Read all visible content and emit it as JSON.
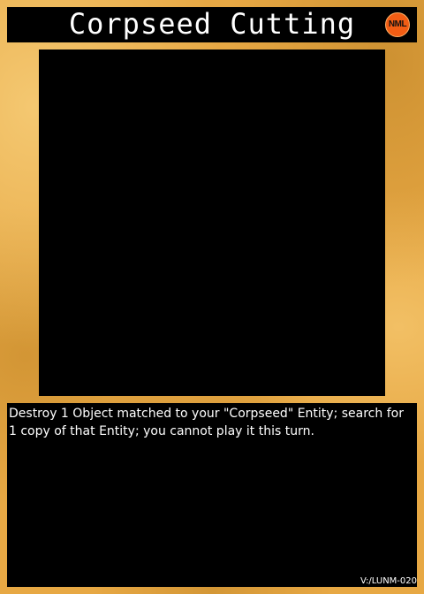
{
  "card": {
    "name": "Corpseed Cutting",
    "set_badge": "NML",
    "effect": "Destroy 1 Object matched to your \"Corpseed\" Entity; search for 1 copy of that Entity; you cannot play it this turn.",
    "code": "V:/LUNM-020",
    "colors": {
      "frame": "#e7a844",
      "panels": "#000000",
      "badge": "#f25d14",
      "text": "#ffffff"
    }
  }
}
